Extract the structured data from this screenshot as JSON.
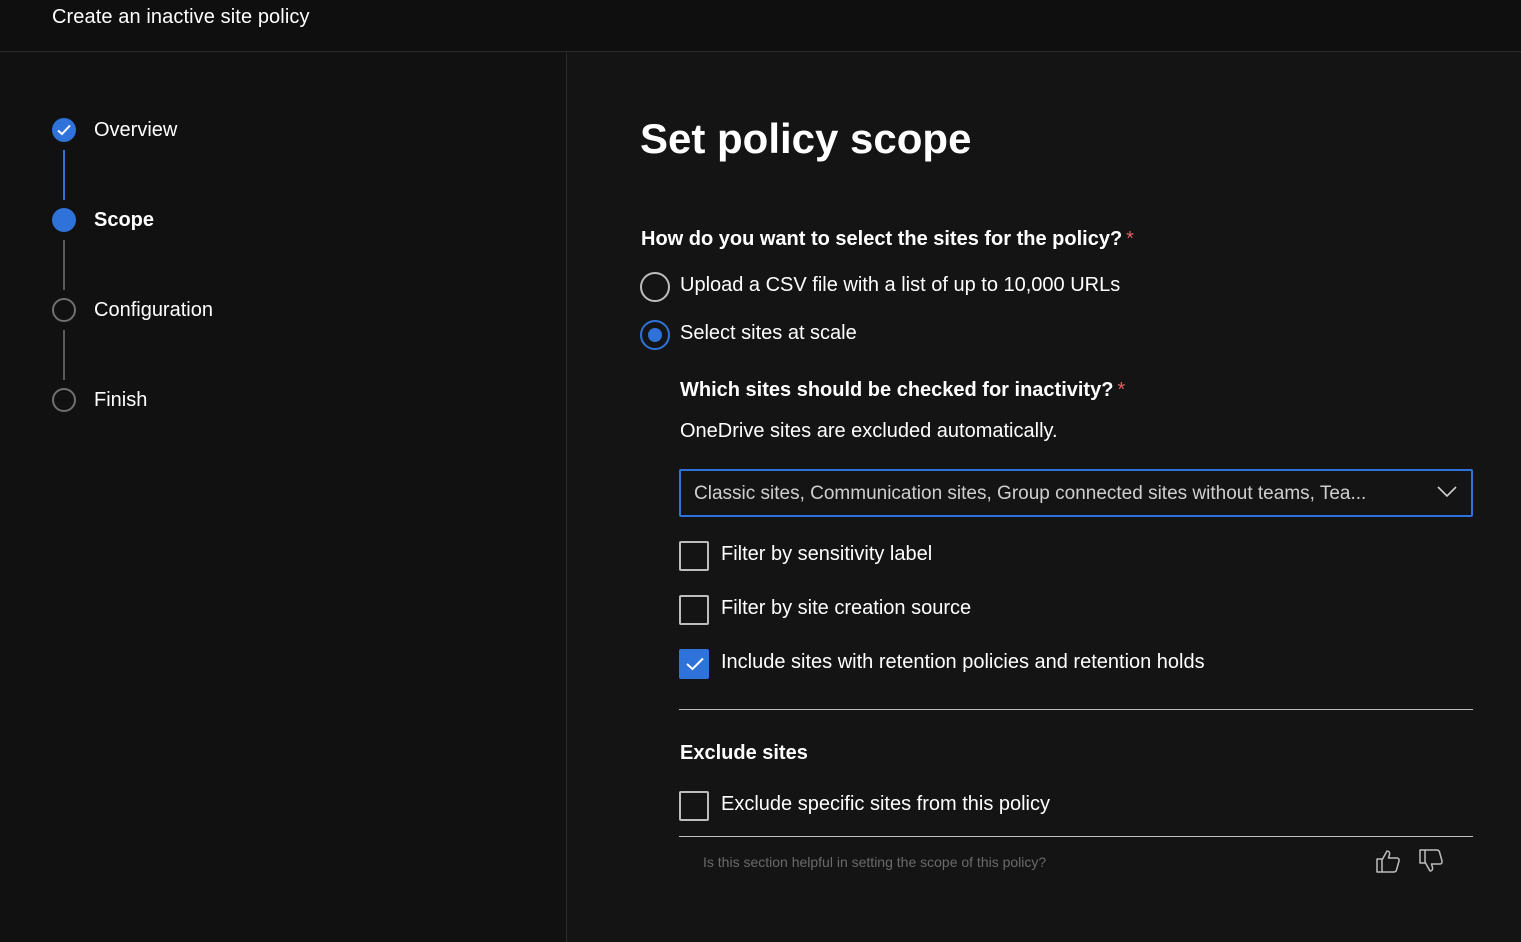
{
  "header": {
    "title": "Create an inactive site policy"
  },
  "wizard": {
    "steps": [
      {
        "label": "Overview",
        "state": "done"
      },
      {
        "label": "Scope",
        "state": "current"
      },
      {
        "label": "Configuration",
        "state": "pending"
      },
      {
        "label": "Finish",
        "state": "pending"
      }
    ]
  },
  "main": {
    "title": "Set policy scope",
    "question1": {
      "label": "How do you want to select the sites for the policy?",
      "required_mark": "*"
    },
    "options": [
      {
        "label": "Upload a CSV file with a list of up to 10,000 URLs",
        "selected": false
      },
      {
        "label": "Select sites at scale",
        "selected": true
      }
    ],
    "question2": {
      "label": "Which sites should be checked for inactivity?",
      "required_mark": "*"
    },
    "description": "OneDrive sites are excluded automatically.",
    "site_types_dropdown": {
      "value": "Classic sites, Communication sites, Group connected sites without teams, Tea..."
    },
    "filters": [
      {
        "label": "Filter by sensitivity label",
        "checked": false
      },
      {
        "label": "Filter by site creation source",
        "checked": false
      },
      {
        "label": "Include sites with retention policies and retention holds",
        "checked": true
      }
    ],
    "exclude_section": {
      "heading": "Exclude sites",
      "checkbox_label": "Exclude specific sites from this policy",
      "checked": false
    },
    "feedback": {
      "prompt": "Is this section helpful in setting the scope of this policy?"
    }
  },
  "colors": {
    "accent": "#2f72d9",
    "background": "#141414",
    "required": "#e06060"
  }
}
